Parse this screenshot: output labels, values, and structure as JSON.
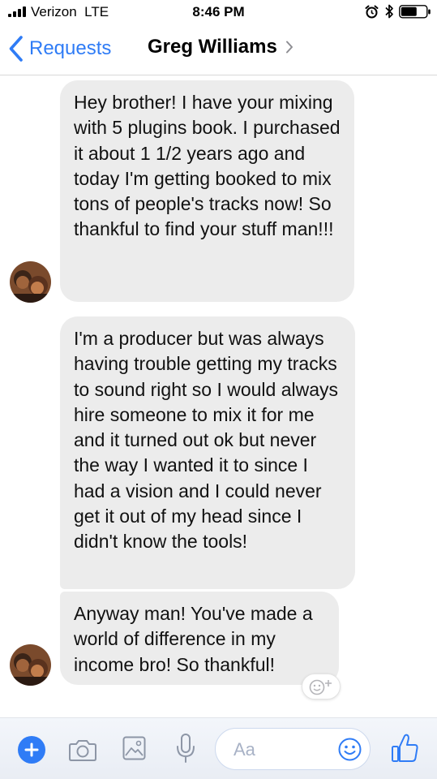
{
  "status_bar": {
    "carrier": "Verizon",
    "network": "LTE",
    "time": "8:46 PM",
    "icons": [
      "signal-icon",
      "alarm-icon",
      "bluetooth-icon",
      "battery-icon"
    ]
  },
  "nav": {
    "back_label": "Requests",
    "title": "Greg Williams",
    "accent_color": "#2f7cf6"
  },
  "messages": [
    {
      "text": "Hey brother! I have your mixing with 5 plugins book. I purchased it about 1 1/2 years ago and today I'm getting booked to mix tons of people's tracks now! So thankful to find your stuff man!!!"
    },
    {
      "text": "I'm a producer but was always having trouble getting my tracks to sound right so I would always hire someone to mix it for me and it turned out ok but never the way I wanted it to since I had a vision and I could never get it out of my head since I didn't know the tools!"
    },
    {
      "text": "Anyway man! You've made a world of difference in my income bro! So thankful!"
    }
  ],
  "composer": {
    "placeholder": "Aa",
    "icons": [
      "plus-icon",
      "camera-icon",
      "image-icon",
      "microphone-icon",
      "emoji-icon",
      "thumbs-up-icon"
    ]
  }
}
